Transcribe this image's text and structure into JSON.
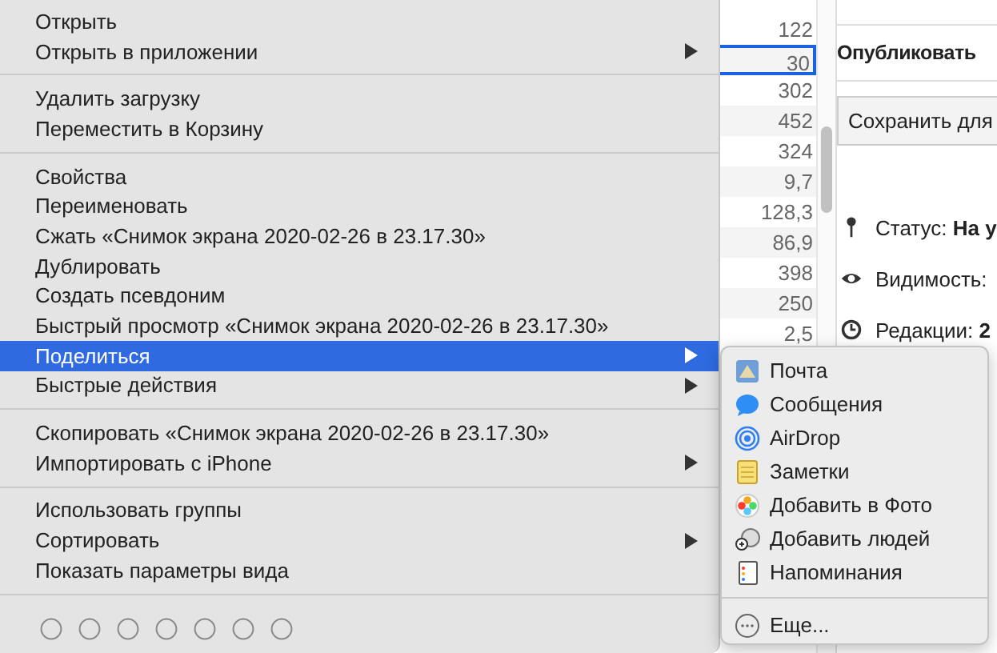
{
  "file_list": {
    "rows": [
      {
        "value": "122",
        "selected": false
      },
      {
        "value": "30",
        "selected": true
      },
      {
        "value": "302",
        "selected": false
      },
      {
        "value": "452",
        "selected": false
      },
      {
        "value": "324",
        "selected": false
      },
      {
        "value": "9,7",
        "selected": false
      },
      {
        "value": "128,3",
        "selected": false
      },
      {
        "value": "86,9",
        "selected": false
      },
      {
        "value": "398",
        "selected": false
      },
      {
        "value": "250",
        "selected": false
      },
      {
        "value": "2,5",
        "selected": false
      }
    ]
  },
  "side_panel": {
    "title": "Опубликовать",
    "save_button": "Сохранить для",
    "meta": [
      {
        "label": "Статус:",
        "value": "На у"
      },
      {
        "label": "Видимость:"
      },
      {
        "label": "Редакции:",
        "value": "2"
      }
    ]
  },
  "context_menu": {
    "groups": [
      [
        {
          "label": "Открыть",
          "has_submenu": false,
          "selected": false
        },
        {
          "label": "Открыть в приложении",
          "has_submenu": true,
          "selected": false
        }
      ],
      [
        {
          "label": "Удалить загрузку",
          "has_submenu": false,
          "selected": false
        },
        {
          "label": "Переместить в Корзину",
          "has_submenu": false,
          "selected": false
        }
      ],
      [
        {
          "label": "Свойства",
          "has_submenu": false,
          "selected": false
        },
        {
          "label": "Переименовать",
          "has_submenu": false,
          "selected": false
        },
        {
          "label": "Сжать «Снимок экрана 2020-02-26 в 23.17.30»",
          "has_submenu": false,
          "selected": false
        },
        {
          "label": "Дублировать",
          "has_submenu": false,
          "selected": false
        },
        {
          "label": "Создать псевдоним",
          "has_submenu": false,
          "selected": false
        },
        {
          "label": "Быстрый просмотр «Снимок экрана 2020-02-26 в 23.17.30»",
          "has_submenu": false,
          "selected": false
        },
        {
          "label": "Поделиться",
          "has_submenu": true,
          "selected": true
        },
        {
          "label": "Быстрые действия",
          "has_submenu": true,
          "selected": false
        }
      ],
      [
        {
          "label": "Скопировать «Снимок экрана 2020-02-26 в 23.17.30»",
          "has_submenu": false,
          "selected": false
        },
        {
          "label": "Импортировать с iPhone",
          "has_submenu": true,
          "selected": false
        }
      ],
      [
        {
          "label": "Использовать группы",
          "has_submenu": false,
          "selected": false
        },
        {
          "label": "Сортировать",
          "has_submenu": true,
          "selected": false
        },
        {
          "label": "Показать параметры вида",
          "has_submenu": false,
          "selected": false
        }
      ]
    ]
  },
  "share_submenu": {
    "items": [
      {
        "label": "Почта"
      },
      {
        "label": "Сообщения"
      },
      {
        "label": "AirDrop"
      },
      {
        "label": "Заметки"
      },
      {
        "label": "Добавить в Фото"
      },
      {
        "label": "Добавить людей"
      },
      {
        "label": "Напоминания"
      }
    ],
    "more": "Еще..."
  }
}
